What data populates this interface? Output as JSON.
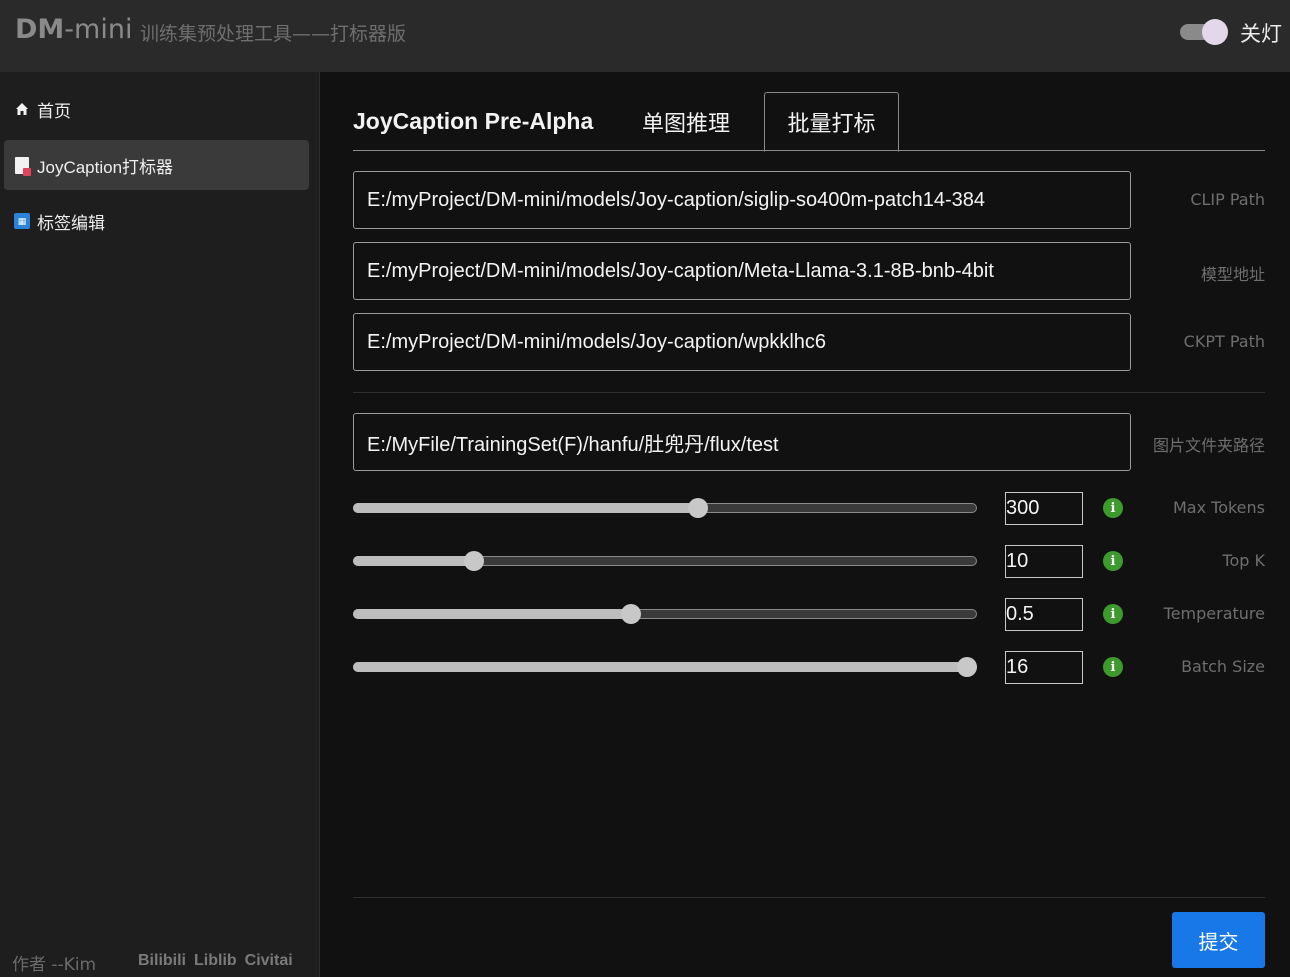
{
  "header": {
    "brand_bold": "DM",
    "brand_rest": "-mini",
    "subtitle": "训练集预处理工具——打标器版",
    "light_toggle_label": "关灯"
  },
  "sidebar": {
    "items": [
      {
        "label": "首页",
        "icon": "home-icon"
      },
      {
        "label": "JoyCaption打标器",
        "icon": "document-icon",
        "active": true
      },
      {
        "label": "标签编辑",
        "icon": "tag-editor-icon"
      }
    ],
    "footer": {
      "author": "作者 --Kim",
      "links": [
        "Bilibili",
        "Liblib",
        "Civitai"
      ]
    }
  },
  "main": {
    "tabs": {
      "title": "JoyCaption Pre-Alpha",
      "tab1": "单图推理",
      "tab2": "批量打标",
      "active": "批量打标"
    },
    "fields": {
      "clip_path": {
        "value": "E:/myProject/DM-mini/models/Joy-caption/siglip-so400m-patch14-384",
        "label": "CLIP Path"
      },
      "model_path": {
        "value": "E:/myProject/DM-mini/models/Joy-caption/Meta-Llama-3.1-8B-bnb-4bit",
        "label": "模型地址"
      },
      "ckpt_path": {
        "value": "E:/myProject/DM-mini/models/Joy-caption/wpkklhc6",
        "label": "CKPT Path"
      },
      "image_folder": {
        "value": "E:/MyFile/TrainingSet(F)/hanfu/肚兜丹/flux/test",
        "label": "图片文件夹路径"
      }
    },
    "sliders": {
      "max_tokens": {
        "value": "300",
        "label": "Max Tokens",
        "fraction": 0.553
      },
      "top_k": {
        "value": "10",
        "label": "Top K",
        "fraction": 0.194
      },
      "temperature": {
        "value": "0.5",
        "label": "Temperature",
        "fraction": 0.446
      },
      "batch_size": {
        "value": "16",
        "label": "Batch Size",
        "fraction": 0.984
      }
    },
    "info_glyph": "i",
    "submit_label": "提交"
  },
  "colors": {
    "accent": "#1878e8",
    "info": "#3d9a2d",
    "background": "#111111",
    "sidebar": "#1e1e1e",
    "header": "#2a2a2a"
  }
}
